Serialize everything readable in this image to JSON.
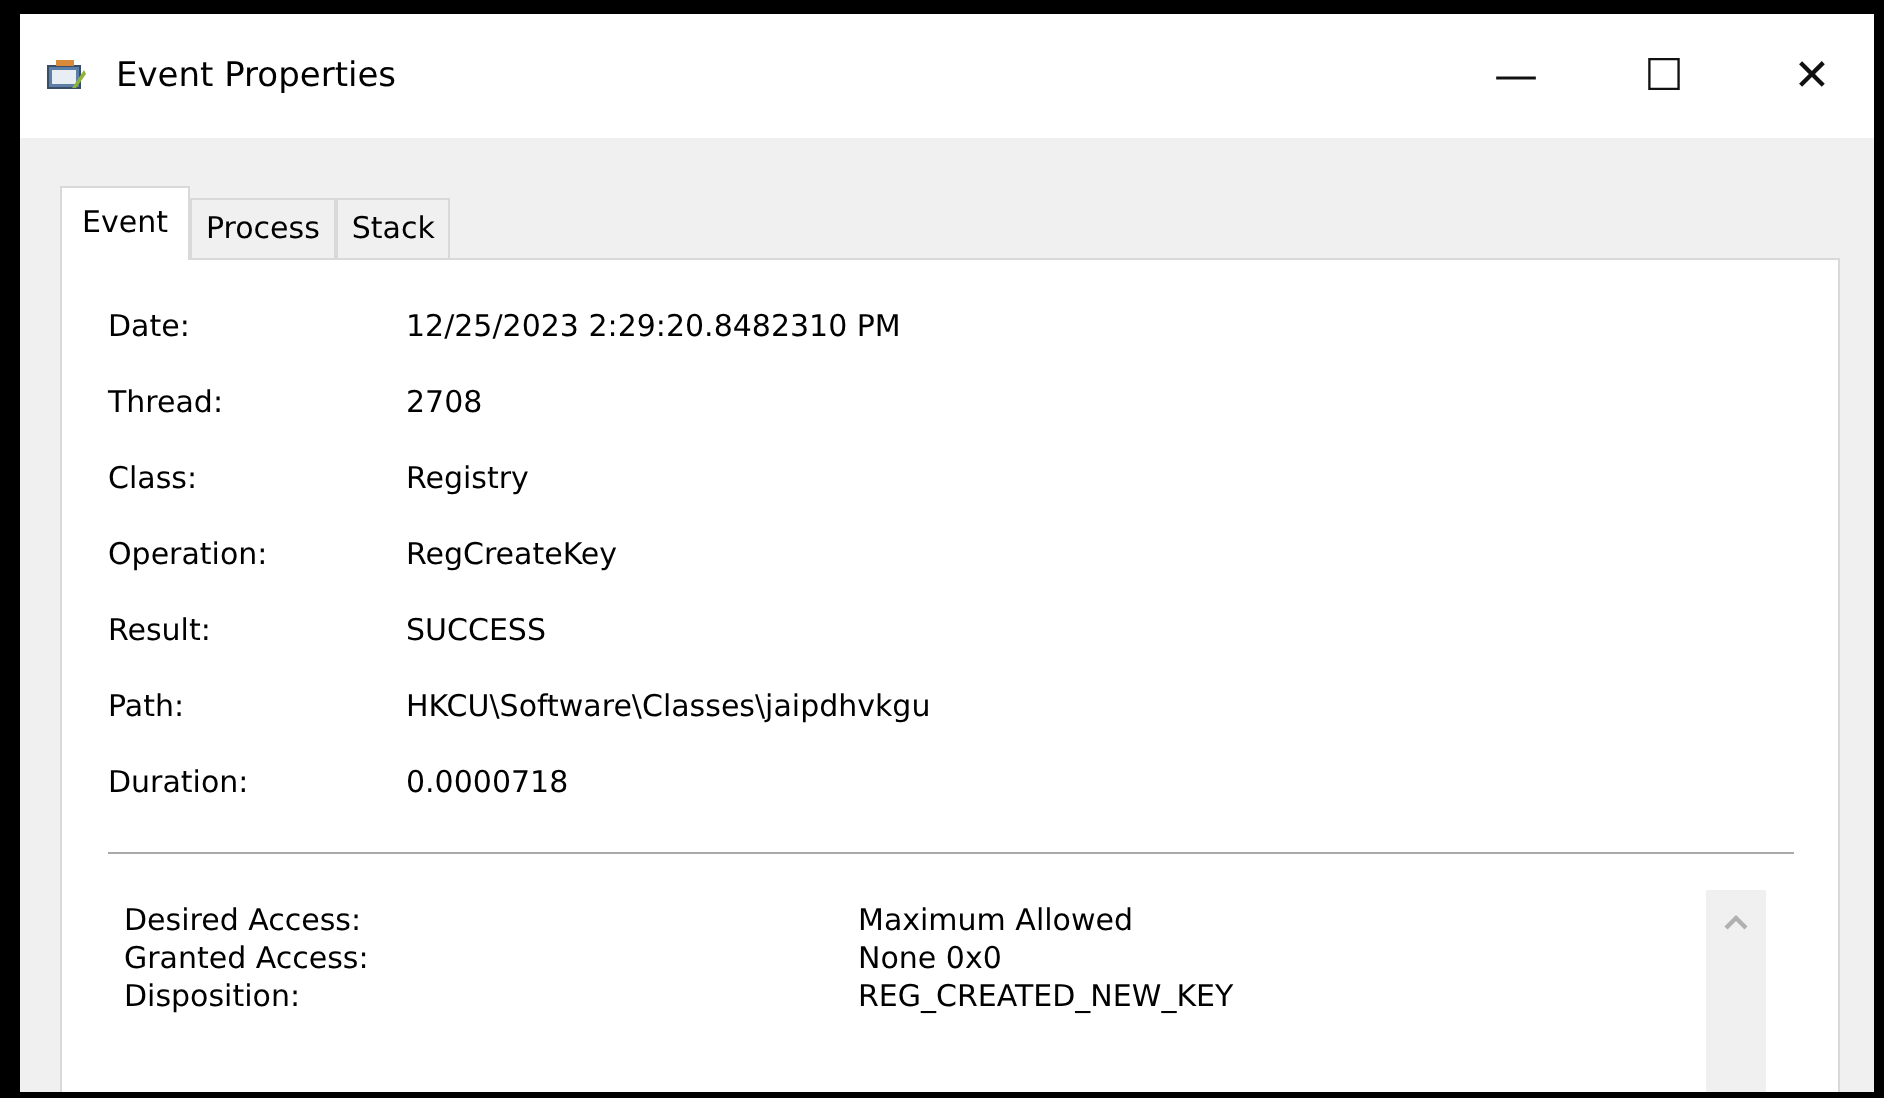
{
  "window": {
    "title": "Event Properties",
    "controls": [
      "—",
      "☐",
      "✕"
    ]
  },
  "tabs": [
    {
      "label": "Event",
      "selected": true
    },
    {
      "label": "Process",
      "selected": false
    },
    {
      "label": "Stack",
      "selected": false
    }
  ],
  "fields": [
    {
      "label": "Date:",
      "value": "12/25/2023 2:29:20.8482310 PM"
    },
    {
      "label": "Thread:",
      "value": "2708"
    },
    {
      "label": "Class:",
      "value": "Registry"
    },
    {
      "label": "Operation:",
      "value": "RegCreateKey"
    },
    {
      "label": "Result:",
      "value": "SUCCESS"
    },
    {
      "label": "Path:",
      "value": "HKCU\\Software\\Classes\\jaipdhvkgu"
    },
    {
      "label": "Duration:",
      "value": "0.0000718"
    }
  ],
  "details": [
    {
      "label": "Desired Access:",
      "value": "Maximum Allowed"
    },
    {
      "label": "Granted Access:",
      "value": "None 0x0"
    },
    {
      "label": "Disposition:",
      "value": "REG_CREATED_NEW_KEY"
    }
  ]
}
